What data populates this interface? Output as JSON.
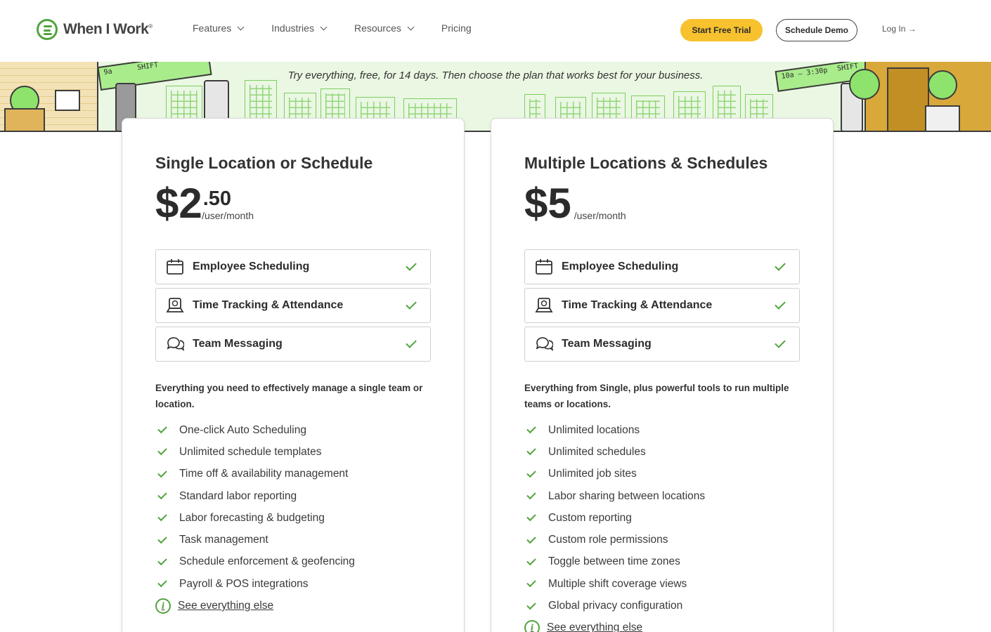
{
  "header": {
    "logo_text": "When I Work",
    "logo_mark": "®",
    "nav": [
      {
        "label": "Features",
        "has_dropdown": true
      },
      {
        "label": "Industries",
        "has_dropdown": true
      },
      {
        "label": "Resources",
        "has_dropdown": true
      },
      {
        "label": "Pricing",
        "has_dropdown": false
      }
    ],
    "cta_trial": "Start Free Trial",
    "cta_demo": "Schedule Demo",
    "login": "Log In →"
  },
  "banner": {
    "text": "Try everything, free, for 14 days. Then choose the plan that works best for your business.",
    "sign_left": "SHIFT",
    "sign_left_time": "9a",
    "sign_right": "SHIFT",
    "sign_right_time": "10a – 3:30p"
  },
  "plans": [
    {
      "title": "Single Location or Schedule",
      "price_dollars": "$2",
      "price_cents": ".50",
      "price_unit": "/user/month",
      "features": [
        {
          "label": "Employee Scheduling",
          "icon": "calendar-icon"
        },
        {
          "label": "Time Tracking & Attendance",
          "icon": "time-clock-icon"
        },
        {
          "label": "Team Messaging",
          "icon": "chat-bubbles-icon"
        }
      ],
      "description": "Everything you need to effectively manage a single team or location.",
      "items": [
        "One-click Auto Scheduling",
        "Unlimited schedule templates",
        "Time off & availability management",
        "Standard labor reporting",
        "Labor forecasting & budgeting",
        "Task management",
        "Schedule enforcement & geofencing",
        "Payroll & POS integrations"
      ],
      "more_link": "See everything else"
    },
    {
      "title": "Multiple Locations & Schedules",
      "price_dollars": "$5",
      "price_cents": "",
      "price_unit": "/user/month",
      "features": [
        {
          "label": "Employee Scheduling",
          "icon": "calendar-icon"
        },
        {
          "label": "Time Tracking & Attendance",
          "icon": "time-clock-icon"
        },
        {
          "label": "Team Messaging",
          "icon": "chat-bubbles-icon"
        }
      ],
      "description": "Everything from Single, plus powerful tools to run multiple teams or locations.",
      "items": [
        "Unlimited locations",
        "Unlimited schedules",
        "Unlimited job sites",
        "Labor sharing between locations",
        "Custom reporting",
        "Custom role permissions",
        "Toggle between time zones",
        "Multiple shift coverage views",
        "Global privacy configuration"
      ],
      "more_link": "See everything else"
    }
  ],
  "colors": {
    "brand_green": "#51a33d",
    "cta_yellow": "#f7c22e",
    "banner_bg": "#eaf7e3"
  }
}
